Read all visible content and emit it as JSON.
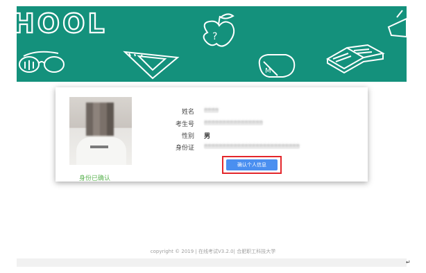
{
  "banner": {
    "text": "HOOL",
    "background": "#14917c",
    "icons": [
      "glasses-icon",
      "apple-icon",
      "ruler-triangle-icon",
      "mouse-icon",
      "book-icon",
      "graduation-cap-icon"
    ]
  },
  "profile": {
    "status": "身份已确认",
    "status_color": "#59b24f",
    "fields": [
      {
        "label": "姓名",
        "value": "••••"
      },
      {
        "label": "考生号",
        "value": "••••••••••••••••"
      },
      {
        "label": "性别",
        "value": "男"
      },
      {
        "label": "身份证",
        "value": "••••••••••••••••••••••••••"
      }
    ],
    "confirm_button": "确认个人信息",
    "button_color": "#4a8ff0",
    "highlight_color": "#e3262b"
  },
  "footer": {
    "text": "copyright © 2019 | 在线考试V3.2.0| 合肥职工科技大学"
  },
  "return_mark": "↵"
}
